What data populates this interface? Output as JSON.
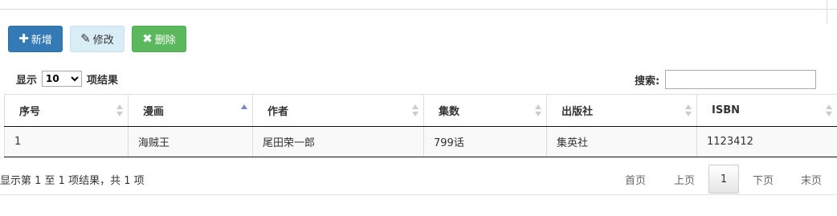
{
  "toolbar": {
    "add_label": "新增",
    "edit_label": "修改",
    "delete_label": "删除"
  },
  "length": {
    "prefix": "显示",
    "value": "10",
    "suffix": "项结果"
  },
  "search": {
    "label": "搜索:",
    "value": ""
  },
  "table": {
    "headers": [
      "序号",
      "漫画",
      "作者",
      "集数",
      "出版社",
      "ISBN"
    ],
    "sorted_column": "漫画",
    "rows": [
      [
        "1",
        "海贼王",
        "尾田荣一郎",
        "799话",
        "集英社",
        "1123412"
      ]
    ]
  },
  "info": "显示第 1 至 1 项结果，共 1 项",
  "pagination": {
    "first": "首页",
    "prev": "上页",
    "current": "1",
    "next": "下页",
    "last": "末页"
  }
}
